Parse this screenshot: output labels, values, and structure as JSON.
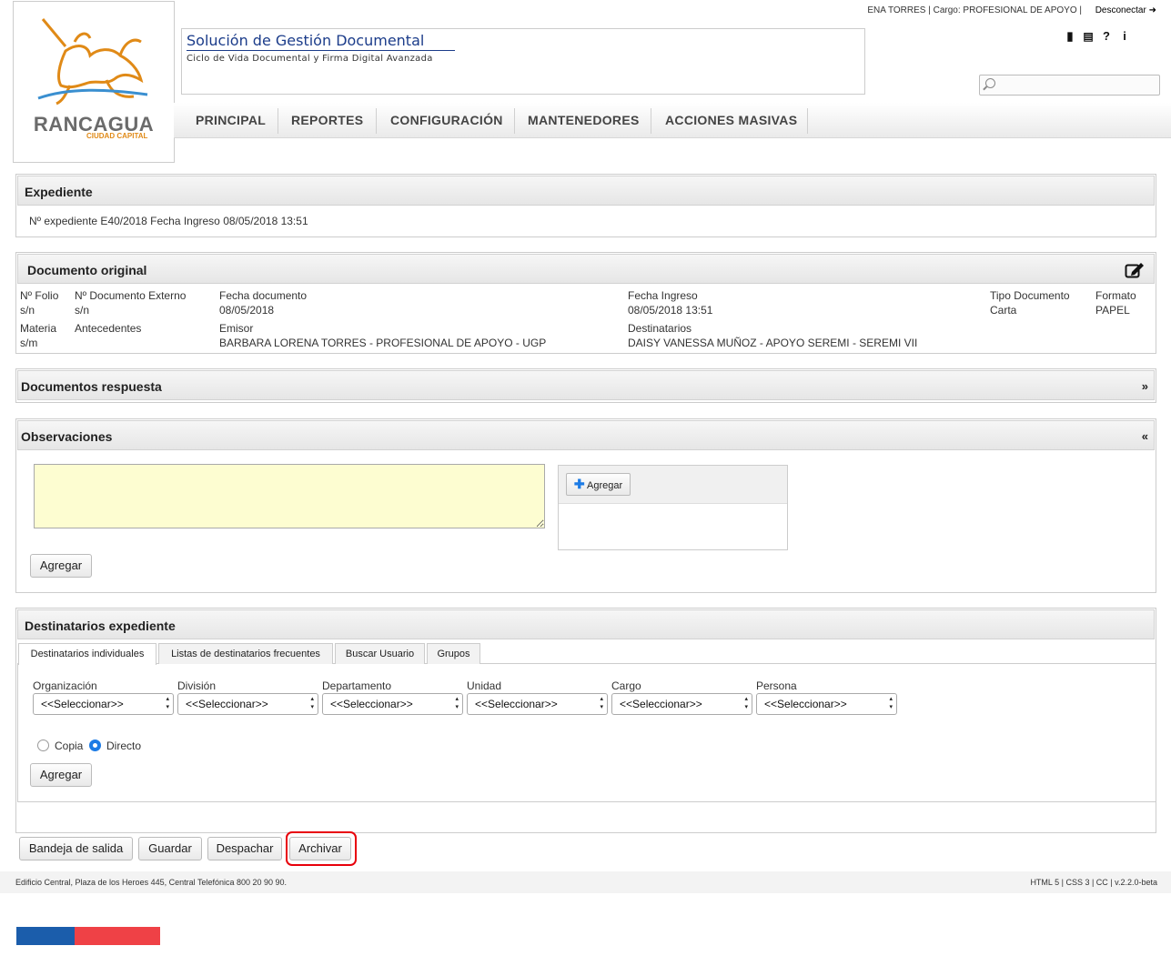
{
  "header": {
    "user_info": "ENA TORRES | Cargo: PROFESIONAL DE APOYO |",
    "logout": "Desconectar",
    "logout_icon": "exit-icon",
    "logo_text": "RANCAGUA",
    "logo_sub": "CIUDAD CAPITAL",
    "app_title": "Solución de Gestión Documental",
    "app_subtitle": "Ciclo de Vida Documental y Firma Digital Avanzada",
    "icons": [
      "book-icon",
      "newspaper-icon",
      "help-icon",
      "info-icon"
    ],
    "search_placeholder": ""
  },
  "nav": [
    "PRINCIPAL",
    "REPORTES",
    "CONFIGURACIÓN",
    "MANTENEDORES",
    "ACCIONES MASIVAS"
  ],
  "expediente": {
    "title": "Expediente",
    "info": "Nº expediente  E40/2018  Fecha Ingreso  08/05/2018 13:51"
  },
  "documento": {
    "title": "Documento original",
    "edit_icon": "edit-icon",
    "folio_label": "Nº Folio",
    "folio_value": "s/n",
    "externo_label": "Nº Documento Externo",
    "externo_value": "s/n",
    "fecha_doc_label": "Fecha documento",
    "fecha_doc_value": "08/05/2018",
    "fecha_ing_label": "Fecha Ingreso",
    "fecha_ing_value": "08/05/2018 13:51",
    "tipo_label": "Tipo Documento",
    "tipo_value": "Carta",
    "formato_label": "Formato",
    "formato_value": "PAPEL",
    "materia_label": "Materia",
    "materia_value": "s/m",
    "antecedentes_label": "Antecedentes",
    "emisor_label": "Emisor",
    "emisor_value": "BARBARA LORENA TORRES - PROFESIONAL DE APOYO - UGP",
    "destinatarios_label": "Destinatarios",
    "destinatarios_value": "DAISY VANESSA MUÑOZ - APOYO SEREMI - SEREMI VII"
  },
  "respuesta": {
    "title": "Documentos respuesta",
    "toggle": "»"
  },
  "observaciones": {
    "title": "Observaciones",
    "toggle": "«",
    "textarea_value": "",
    "add_attachment": "Agregar",
    "add_button": "Agregar"
  },
  "destinatarios": {
    "title": "Destinatarios expediente",
    "tabs": [
      "Destinatarios individuales",
      "Listas de destinatarios frecuentes",
      "Buscar Usuario",
      "Grupos"
    ],
    "fields": [
      {
        "label": "Organización",
        "value": "<<Seleccionar>>"
      },
      {
        "label": "División",
        "value": "<<Seleccionar>>"
      },
      {
        "label": "Departamento",
        "value": "<<Seleccionar>>"
      },
      {
        "label": "Unidad",
        "value": "<<Seleccionar>>"
      },
      {
        "label": "Cargo",
        "value": "<<Seleccionar>>"
      },
      {
        "label": "Persona",
        "value": "<<Seleccionar>>"
      }
    ],
    "radio_copia": "Copia",
    "radio_directo": "Directo",
    "add_button": "Agregar"
  },
  "actions": [
    "Bandeja de salida",
    "Guardar",
    "Despachar",
    "Archivar"
  ],
  "footer": {
    "address": "Edificio Central, Plaza de los Heroes 445, Central Telefónica 800 20 90 90.",
    "meta": "HTML 5 | CSS 3 | CC | v.2.2.0-beta"
  },
  "colors": {
    "accent": "#1b3c8a",
    "flag_blue": "#1b5dab",
    "flag_red": "#ef4146",
    "highlight": "#e8000b",
    "textarea_bg": "#fdfdd1"
  }
}
